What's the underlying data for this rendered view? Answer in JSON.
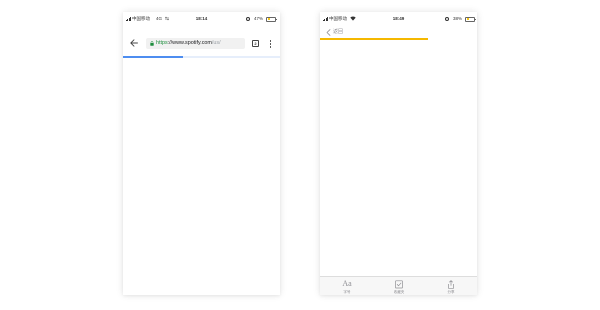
{
  "left_phone": {
    "status": {
      "carrier": "中国移动",
      "network": "4G",
      "time": "18:14",
      "battery_percent": "47%",
      "battery_level": 0.47
    },
    "browser": {
      "url_scheme": "https",
      "url_rest": "://www.spotify.com",
      "url_path": "/us/",
      "tab_count": "2",
      "page_load_progress": 0.38,
      "icons": [
        "back-arrow-icon",
        "lock-icon",
        "tabs-icon",
        "more-icon"
      ]
    }
  },
  "right_phone": {
    "status": {
      "carrier": "中国移动",
      "time": "18:49",
      "battery_percent": "38%",
      "battery_level": 0.38
    },
    "nav": {
      "back_label": "返回",
      "page_load_progress": 0.69
    },
    "tab_bar": {
      "items": [
        {
          "label": "字号",
          "glyph": "Aa",
          "icon": "font-size-icon"
        },
        {
          "label": "收藏夹",
          "icon": "bookmark-add-icon"
        },
        {
          "label": "分享",
          "icon": "share-icon"
        }
      ]
    }
  },
  "colors": {
    "url_green": "#1e8e3e",
    "progress_blue": "#4d8df0",
    "progress_yellow": "#f5b800",
    "battery_yellow": "#f5c518"
  }
}
